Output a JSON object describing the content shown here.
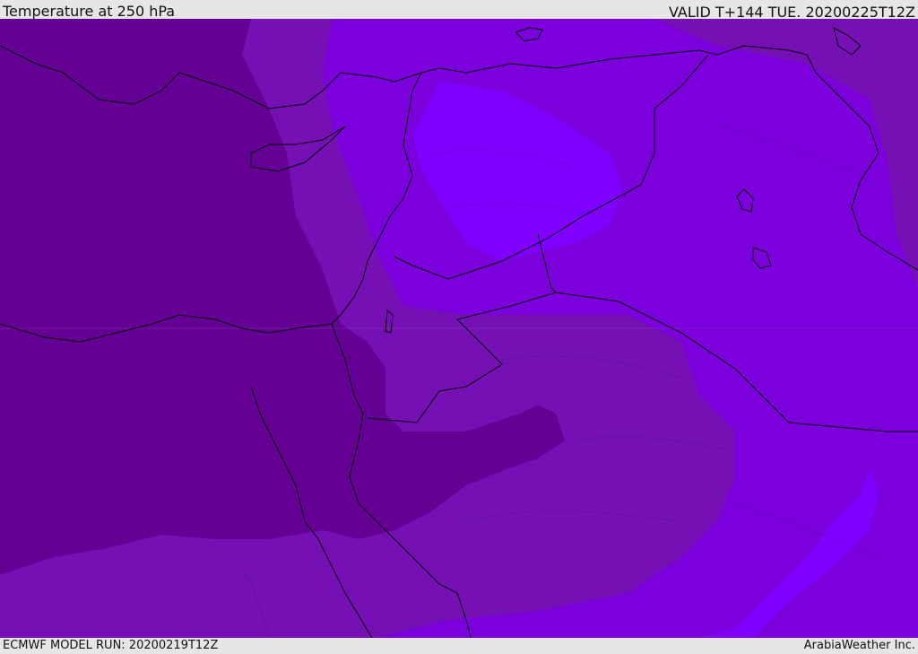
{
  "header": {
    "title": "Temperature at 250 hPa",
    "valid": "VALID T+144 TUE. 20200225T12Z"
  },
  "footer": {
    "model_run": "ECMWF MODEL RUN: 20200219T12Z",
    "credit": "ArabiaWeather Inc."
  },
  "colors": {
    "darkest": "#650095",
    "dark": "#7510b5",
    "medium": "#7c00dc",
    "light": "#8000ff",
    "border": "#000000"
  }
}
